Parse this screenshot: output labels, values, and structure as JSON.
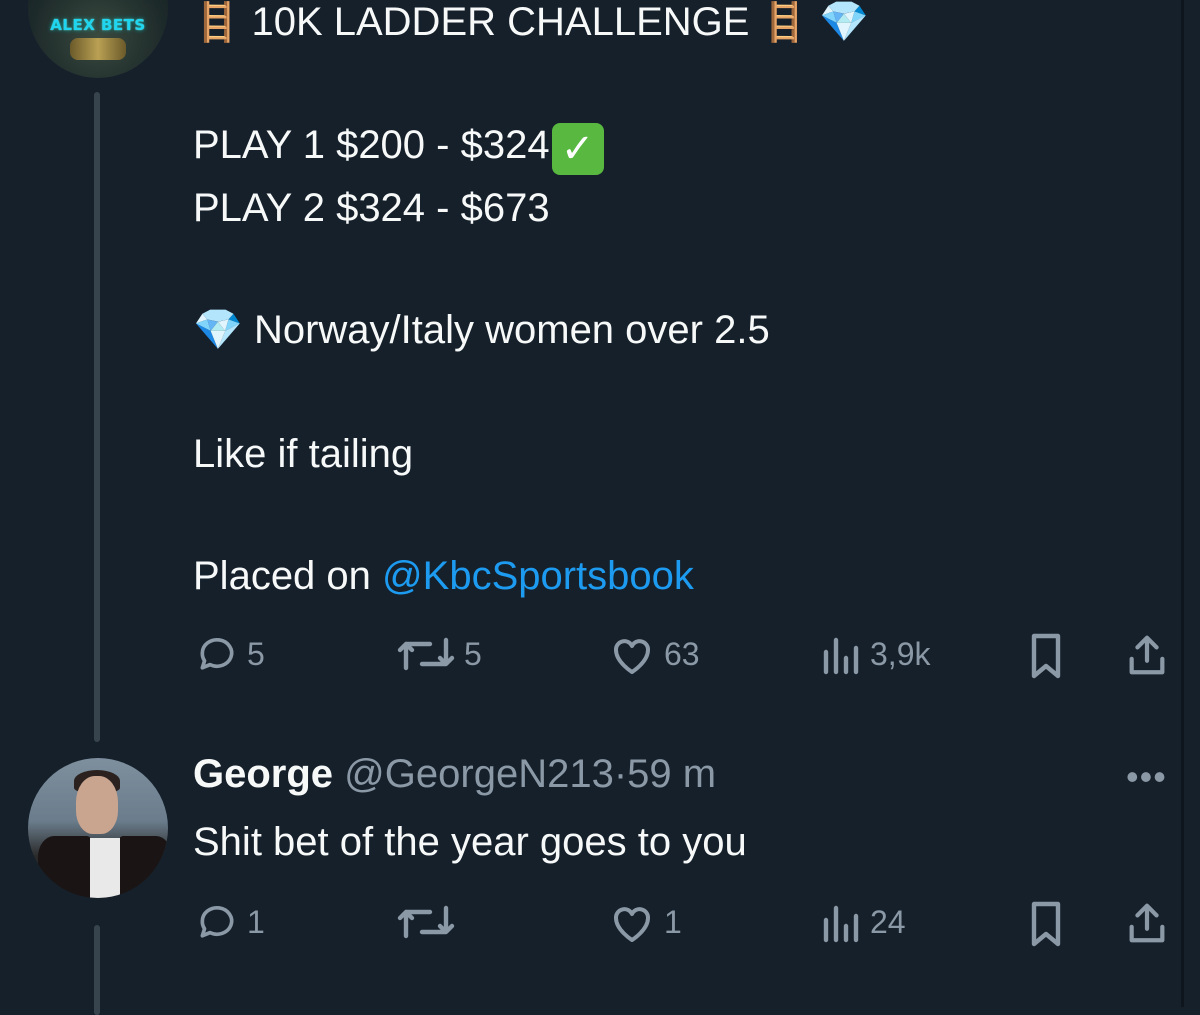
{
  "colors": {
    "background": "#15202b",
    "text": "#f7f9f9",
    "muted": "#8b98a5",
    "link": "#1d9bf0",
    "thread_line": "#38444d"
  },
  "tweet": {
    "avatar_text": "ALEX BETS",
    "title": "10K LADDER CHALLENGE",
    "play1": "PLAY 1 $200 - $324",
    "play2": "PLAY 2 $324 - $673",
    "pick": "Norway/Italy women over 2.5",
    "cta": "Like if tailing",
    "placed_prefix": "Placed on ",
    "placed_mention": "@KbcSportsbook",
    "icons": [
      "ladder-icon",
      "diamond-icon",
      "check-mark-icon"
    ],
    "stats": {
      "replies": "5",
      "retweets": "5",
      "likes": "63",
      "views": "3,9k"
    }
  },
  "reply": {
    "name": "George",
    "handle": "@GeorgeN213",
    "separator": "·",
    "time": "59 m",
    "text": "Shit bet of the year goes to you",
    "more": "•••",
    "stats": {
      "replies": "1",
      "retweets": "",
      "likes": "1",
      "views": "24"
    }
  }
}
